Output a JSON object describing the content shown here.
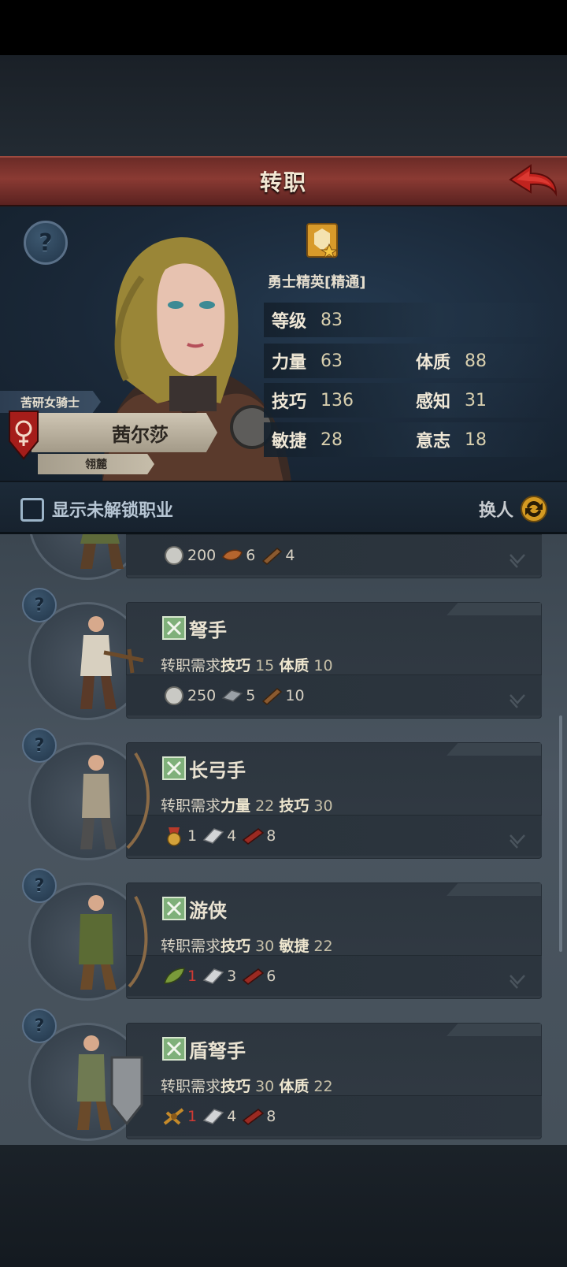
{
  "header": {
    "title": "转职"
  },
  "hero": {
    "class_name": "勇士精英[精通]",
    "stats": [
      {
        "label": "等级",
        "value": "83"
      },
      {
        "label": "力量",
        "value": "63"
      },
      {
        "label": "体质",
        "value": "88"
      },
      {
        "label": "技巧",
        "value": "136"
      },
      {
        "label": "感知",
        "value": "31"
      },
      {
        "label": "敏捷",
        "value": "28"
      },
      {
        "label": "意志",
        "value": "18"
      }
    ],
    "title_ribbon": "苦研女骑士",
    "character_name": "茜尔莎",
    "sub_title": "翎麓"
  },
  "toolbar": {
    "show_locked_label": "显示未解锁职业",
    "swap_label": "换人"
  },
  "jobs": [
    {
      "name": "",
      "req_prefix": "",
      "reqs": [],
      "costs": [
        {
          "icon": "silver-coin-icon",
          "amount": "200",
          "lacking": false
        },
        {
          "icon": "leather-icon",
          "amount": "6",
          "lacking": false
        },
        {
          "icon": "wood-plank-icon",
          "amount": "4",
          "lacking": false
        }
      ]
    },
    {
      "name": "弩手",
      "req_prefix": "转职需求",
      "reqs": [
        {
          "k": "技巧",
          "v": "15"
        },
        {
          "k": "体质",
          "v": "10"
        }
      ],
      "costs": [
        {
          "icon": "silver-coin-icon",
          "amount": "250",
          "lacking": false
        },
        {
          "icon": "iron-ingot-icon",
          "amount": "5",
          "lacking": false
        },
        {
          "icon": "wood-plank-icon",
          "amount": "10",
          "lacking": false
        }
      ]
    },
    {
      "name": "长弓手",
      "req_prefix": "转职需求",
      "reqs": [
        {
          "k": "力量",
          "v": "22"
        },
        {
          "k": "技巧",
          "v": "30"
        }
      ],
      "costs": [
        {
          "icon": "medal-icon",
          "amount": "1",
          "lacking": false
        },
        {
          "icon": "silver-ingot-icon",
          "amount": "4",
          "lacking": false
        },
        {
          "icon": "red-wood-icon",
          "amount": "8",
          "lacking": false
        }
      ]
    },
    {
      "name": "游侠",
      "req_prefix": "转职需求",
      "reqs": [
        {
          "k": "技巧",
          "v": "30"
        },
        {
          "k": "敏捷",
          "v": "22"
        }
      ],
      "costs": [
        {
          "icon": "feather-icon",
          "amount": "1",
          "lacking": true
        },
        {
          "icon": "silver-ingot-icon",
          "amount": "3",
          "lacking": false
        },
        {
          "icon": "red-wood-icon",
          "amount": "6",
          "lacking": false
        }
      ]
    },
    {
      "name": "盾弩手",
      "req_prefix": "转职需求",
      "reqs": [
        {
          "k": "技巧",
          "v": "30"
        },
        {
          "k": "体质",
          "v": "22"
        }
      ],
      "costs": [
        {
          "icon": "crossbow-part-icon",
          "amount": "1",
          "lacking": true
        },
        {
          "icon": "silver-ingot-icon",
          "amount": "4",
          "lacking": false
        },
        {
          "icon": "red-wood-icon",
          "amount": "8",
          "lacking": false
        }
      ]
    }
  ]
}
